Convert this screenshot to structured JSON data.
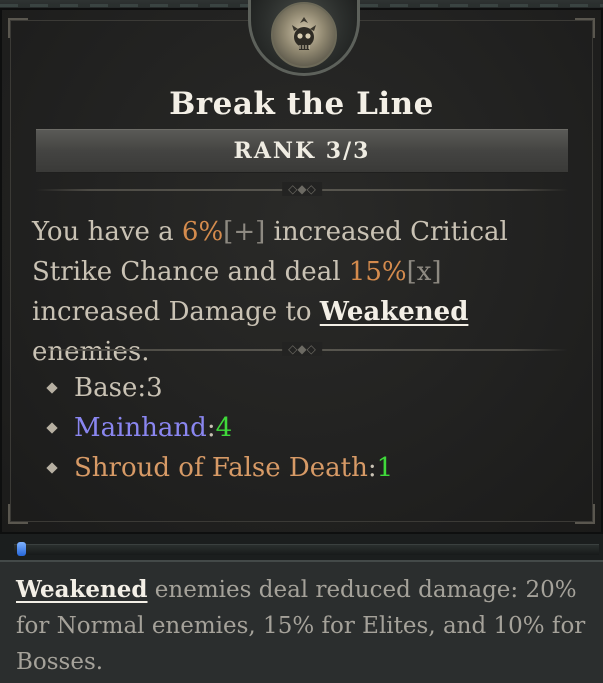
{
  "skill": {
    "title": "Break the Line",
    "rank_label": "RANK 3/3",
    "icon": "skull-emblem-icon"
  },
  "description": {
    "p1": "You have a ",
    "crit_value": "6%",
    "crit_bracket": "[+]",
    "p2": " increased Critical Strike Chance and deal ",
    "dmg_value": "15%",
    "dmg_bracket": "[x]",
    "p3": " increased Damage to ",
    "keyword": "Weakened",
    "p4": " enemies."
  },
  "ranks": [
    {
      "label": "Base",
      "sep": ": ",
      "value": "3"
    },
    {
      "label": "Mainhand",
      "sep": ": ",
      "value": "4"
    },
    {
      "label": "Shroud of False Death",
      "sep": ": ",
      "value": "1"
    }
  ],
  "keyword_tooltip": {
    "keyword": "Weakened",
    "text": " enemies deal reduced damage: 20% for Normal enemies, 15% for Elites, and 10% for Bosses."
  },
  "colors": {
    "value_orange": "#d48b4d",
    "mainhand_purple": "#8a86f0",
    "unique_orange": "#d79a66",
    "bonus_green": "#3fd93a"
  }
}
